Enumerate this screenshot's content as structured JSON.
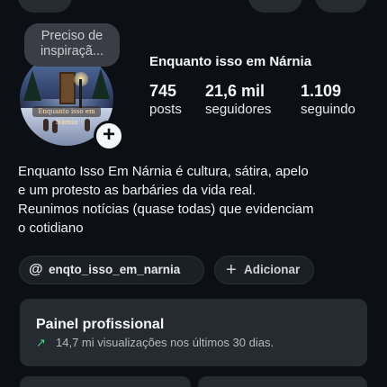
{
  "note": {
    "text_line1": "Preciso de",
    "text_line2": "inspiraçã..."
  },
  "avatar": {
    "sign_text": "Enquanto isso em Nárnia"
  },
  "profile": {
    "display_name": "Enquanto isso em Nárnia",
    "stats": {
      "posts": {
        "value": "745",
        "label": "posts"
      },
      "followers": {
        "value": "21,6 mil",
        "label": "seguidores"
      },
      "following": {
        "value": "1.109",
        "label": "seguindo"
      }
    },
    "bio_lines": [
      "Enquanto Isso Em Nárnia é cultura, sátira, apelo",
      "e um protesto as barbáries da vida real.",
      "Reunimos notícias (quase todas) que evidenciam",
      "o cotidiano"
    ]
  },
  "links": {
    "threads_handle": "enqto_isso_em_narnia",
    "threads_icon": "threads-icon",
    "add_label": "Adicionar",
    "add_icon": "plus-icon"
  },
  "professional_panel": {
    "title": "Painel profissional",
    "summary": "14,7 mi visualizações nos últimos 30 dias.",
    "trend_icon": "trending-up-icon",
    "trend_color": "#4ad17b"
  },
  "colors": {
    "background": "#0c0f14",
    "surface": "#262a31",
    "text": "#f5f6f8"
  }
}
